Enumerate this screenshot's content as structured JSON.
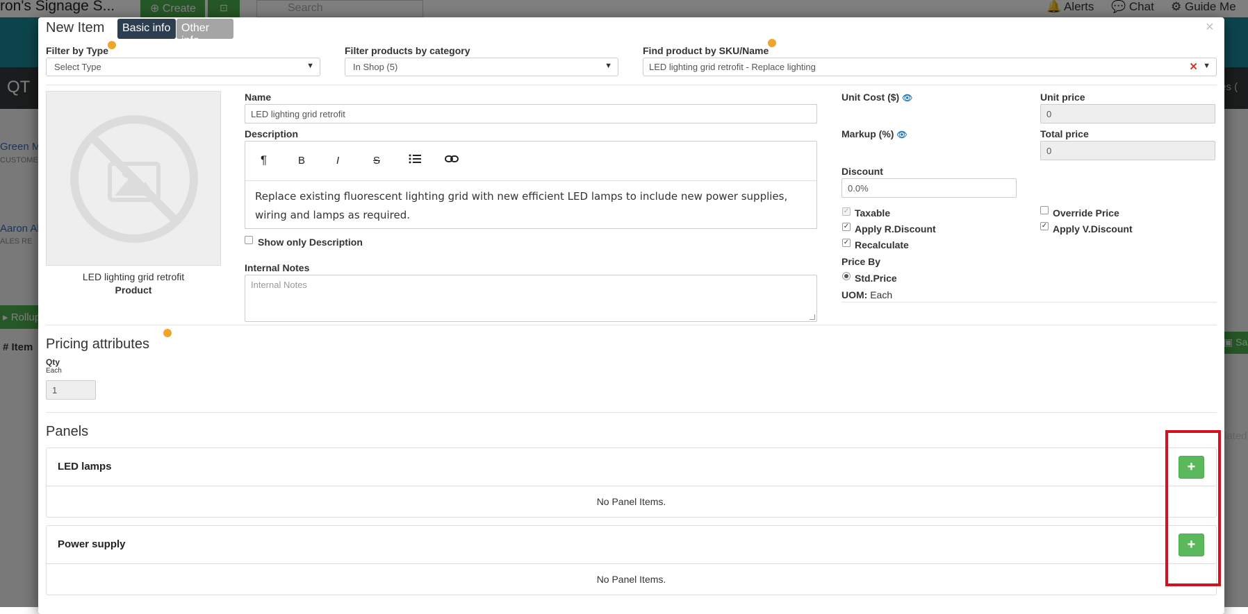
{
  "background": {
    "brand": "ron's Signage S...",
    "create_label": "Create",
    "search_placeholder": "Search",
    "alerts_label": "Alerts",
    "chat_label": "Chat",
    "guide_label": "Guide Me",
    "page_title": "QT",
    "side_items": [
      {
        "name": "Green M",
        "role": "CUSTOME"
      },
      {
        "name": "Aaron Al",
        "role": "ALES RE"
      }
    ],
    "rollup_label": "Rollup",
    "item_header": "# Item",
    "right_fragment_1": "tes (",
    "right_fragment_2": "lated",
    "save_label": "Sa"
  },
  "modal": {
    "title": "New Item",
    "tabs": [
      {
        "label": "Basic info",
        "active": true
      },
      {
        "label": "Other info",
        "active": false
      }
    ],
    "close": "×"
  },
  "filters": {
    "type_label": "Filter by Type",
    "type_value": "Select Type",
    "category_label": "Filter products by category",
    "category_value": "In Shop (5)",
    "sku_label": "Find product by SKU/Name",
    "sku_value": "LED lighting grid retrofit - Replace lighting"
  },
  "product": {
    "image_icon": "no-image-icon",
    "name": "LED lighting grid retrofit",
    "type": "Product"
  },
  "form": {
    "name_label": "Name",
    "name_value": "LED lighting grid retrofit",
    "description_label": "Description",
    "toolbar": [
      "¶",
      "B",
      "I",
      "S",
      "list",
      "link"
    ],
    "description_text": "Replace existing fluorescent lighting grid with new efficient LED lamps to include new power supplies, wiring and lamps as required.",
    "show_only_desc_label": "Show only Description",
    "internal_notes_label": "Internal Notes",
    "internal_notes_placeholder": "Internal Notes"
  },
  "pricing": {
    "unit_cost_label": "Unit Cost ($)",
    "unit_price_label": "Unit price",
    "unit_price_value": "0",
    "markup_label": "Markup (%)",
    "total_price_label": "Total price",
    "total_price_value": "0",
    "discount_label": "Discount",
    "discount_value": "0.0%",
    "checks": {
      "taxable": "Taxable",
      "apply_r_discount": "Apply R.Discount",
      "recalculate": "Recalculate",
      "override_price": "Override Price",
      "apply_v_discount": "Apply V.Discount"
    },
    "price_by_label": "Price By",
    "price_by_option": "Std.Price",
    "uom_label": "UOM:",
    "uom_value": "Each"
  },
  "pricing_attributes": {
    "title": "Pricing attributes",
    "qty_label": "Qty",
    "qty_unit": "Each",
    "qty_value": "1"
  },
  "panels": {
    "title": "Panels",
    "items": [
      {
        "name": "LED lamps",
        "empty": "No Panel Items."
      },
      {
        "name": "Power supply",
        "empty": "No Panel Items."
      }
    ],
    "add_label": "+"
  },
  "colors": {
    "accent_dot": "#f0a52a",
    "add_button": "#5cb85c",
    "highlight": "#d4121f",
    "tab_active": "#2d3e50",
    "tab_inactive": "#a5a5a5"
  }
}
